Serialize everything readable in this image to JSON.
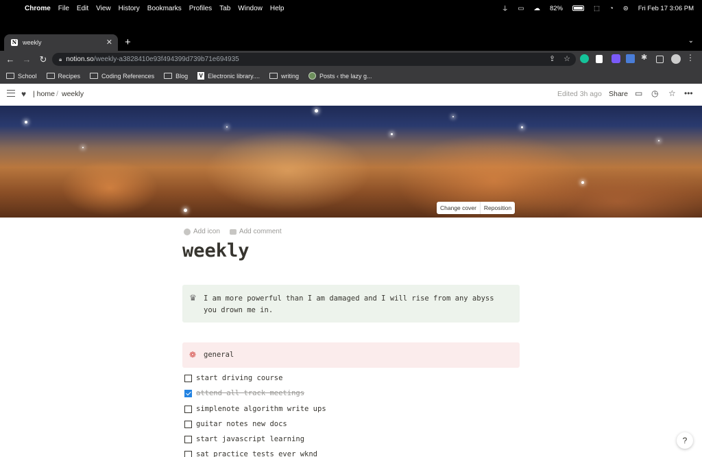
{
  "menubar": {
    "app": "Chrome",
    "items": [
      "File",
      "Edit",
      "View",
      "History",
      "Bookmarks",
      "Profiles",
      "Tab",
      "Window",
      "Help"
    ],
    "battery": "82%",
    "datetime": "Fri Feb 17  3:06 PM"
  },
  "browser": {
    "tab_title": "weekly",
    "url_host": "notion.so",
    "url_path": "/weekly-a3828410e93f494399d739b71e694935",
    "bookmarks": [
      "School",
      "Recipes",
      "Coding References",
      "Blog",
      "Electronic library....",
      "writing",
      "Posts ‹ the lazy g..."
    ]
  },
  "notion": {
    "breadcrumb_home": "| home",
    "breadcrumb_sep": "/",
    "breadcrumb_page": "weekly",
    "edited": "Edited 3h ago",
    "share": "Share",
    "change_cover": "Change cover",
    "reposition": "Reposition",
    "add_icon": "Add icon",
    "add_comment": "Add comment",
    "title": "weekly",
    "quote_callout": "I am more powerful than I am damaged and I will rise from any abyss you drown me in.",
    "section_heading": "general",
    "todos": [
      {
        "label": "start driving course",
        "checked": false
      },
      {
        "label": "attend all track meetings",
        "checked": true
      },
      {
        "label": "simplenote algorithm write ups",
        "checked": false
      },
      {
        "label": "guitar notes new docs",
        "checked": false
      },
      {
        "label": "start javascript learning",
        "checked": false
      },
      {
        "label": "sat practice tests ever wknd",
        "checked": false
      }
    ],
    "help": "?"
  },
  "colors": {
    "accent": "#2383e2",
    "callout_green": "#edf3ec",
    "callout_red": "#fbecec"
  }
}
